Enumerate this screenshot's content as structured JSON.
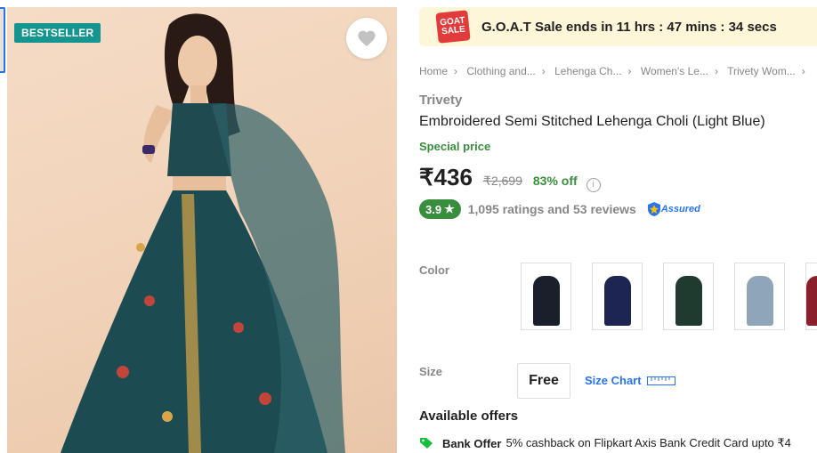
{
  "badge": "BESTSELLER",
  "sale": {
    "logo_line1": "GOAT",
    "logo_line2": "SALE",
    "text": "G.O.A.T Sale ends in 11 hrs : 47 mins : 34 secs"
  },
  "breadcrumb": [
    "Home",
    "Clothing and...",
    "Lehenga Ch...",
    "Women's Le...",
    "Trivety Wom..."
  ],
  "product": {
    "brand": "Trivety",
    "title": "Embroidered Semi Stitched Lehenga Choli  (Light Blue)",
    "special_price_label": "Special price",
    "price": "₹436",
    "mrp": "₹2,699",
    "discount": "83% off",
    "rating": "3.9",
    "ratings_reviews": "1,095 ratings and 53 reviews",
    "assured": "Assured"
  },
  "color": {
    "label": "Color",
    "swatches": [
      "#1b1f2b",
      "#1d2552",
      "#1f3a2f",
      "#8fa6b8",
      "#8a1f2b"
    ]
  },
  "size": {
    "label": "Size",
    "value": "Free",
    "chart_label": "Size Chart"
  },
  "offers": {
    "title": "Available offers",
    "items": [
      {
        "type": "Bank Offer",
        "text": "5% cashback on Flipkart Axis Bank Credit Card upto ₹4"
      }
    ]
  },
  "colors": {
    "accent": "#2874f0",
    "green": "#388e3c",
    "badge": "#14958f",
    "banner": "#fdf6d8"
  }
}
